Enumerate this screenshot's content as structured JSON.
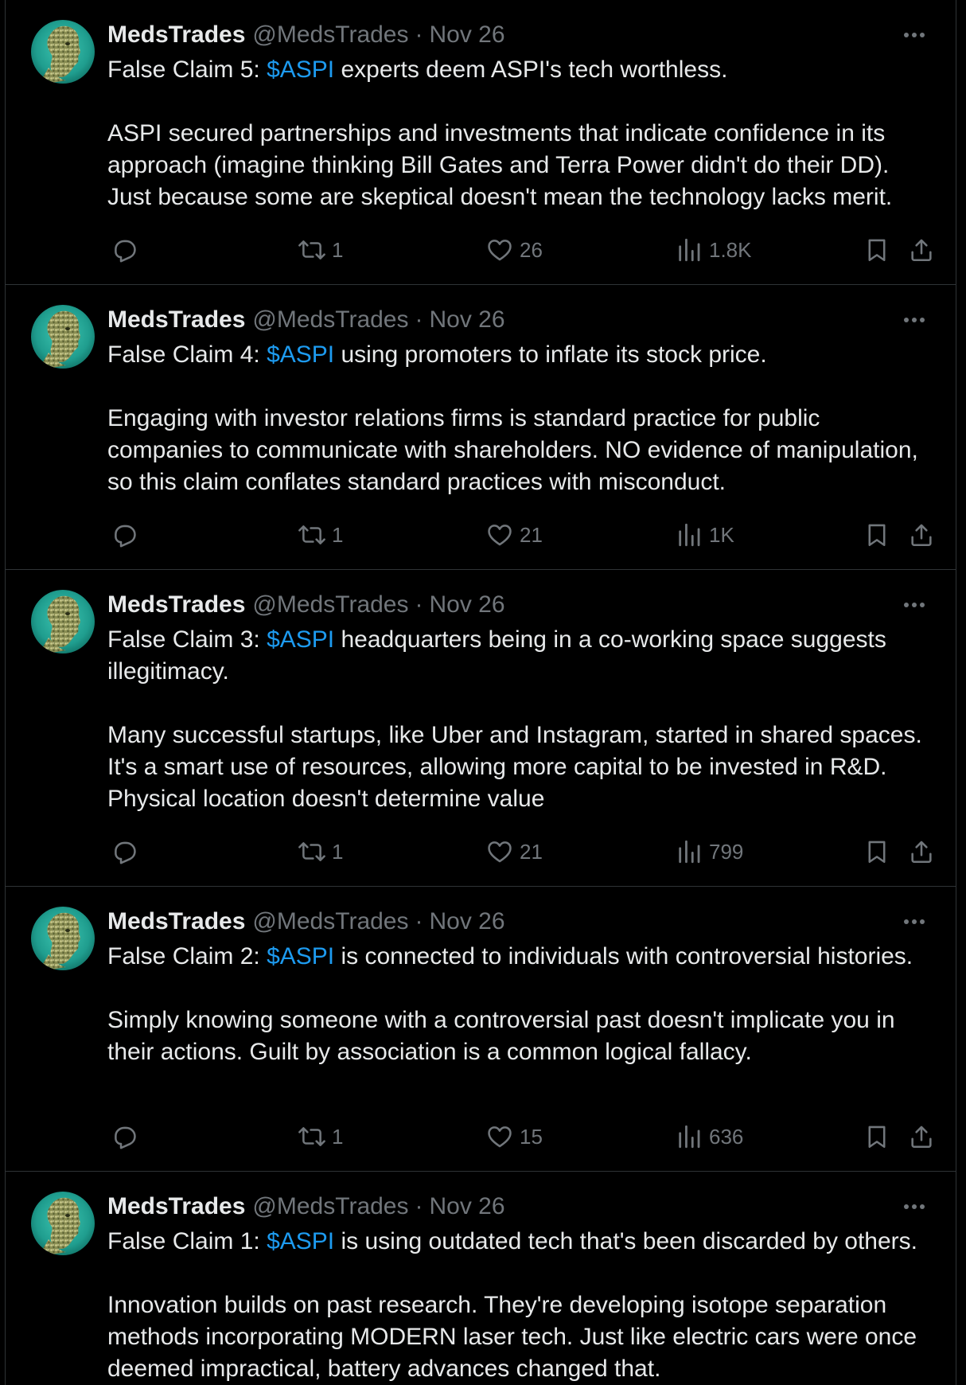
{
  "accent_color": "#1d9bf0",
  "tweets": [
    {
      "author": {
        "name": "MedsTrades",
        "handle": "@MedsTrades",
        "separator": "·",
        "date": "Nov 26"
      },
      "claim_prefix": "False Claim 5: ",
      "cashtag": "$ASPI",
      "claim_text": " experts deem ASPI's tech worthless.",
      "body": "ASPI secured partnerships and investments that indicate confidence in its approach (imagine thinking Bill Gates and Terra Power didn't do their DD). Just because some are skeptical doesn't mean the technology lacks merit.",
      "stats": {
        "replies": "",
        "retweets": "1",
        "likes": "26",
        "views": "1.8K"
      }
    },
    {
      "author": {
        "name": "MedsTrades",
        "handle": "@MedsTrades",
        "separator": "·",
        "date": "Nov 26"
      },
      "claim_prefix": "False Claim 4: ",
      "cashtag": "$ASPI",
      "claim_text": " using promoters to inflate its stock price.",
      "body": "Engaging with investor relations firms is standard practice for public companies to communicate with shareholders. NO evidence of manipulation, so this claim conflates standard practices with misconduct.",
      "stats": {
        "replies": "",
        "retweets": "1",
        "likes": "21",
        "views": "1K"
      }
    },
    {
      "author": {
        "name": "MedsTrades",
        "handle": "@MedsTrades",
        "separator": "·",
        "date": "Nov 26"
      },
      "claim_prefix": "False Claim 3: ",
      "cashtag": "$ASPI",
      "claim_text": " headquarters being in a co-working space suggests illegitimacy.",
      "body": "Many successful startups, like Uber and Instagram, started in shared spaces. It's a smart use of resources, allowing more capital to be invested in R&D. Physical location doesn't determine value",
      "stats": {
        "replies": "",
        "retweets": "1",
        "likes": "21",
        "views": "799"
      }
    },
    {
      "author": {
        "name": "MedsTrades",
        "handle": "@MedsTrades",
        "separator": "·",
        "date": "Nov 26"
      },
      "claim_prefix": "False Claim 2: ",
      "cashtag": "$ASPI",
      "claim_text": " is connected to individuals with controversial histories.",
      "body": "Simply knowing someone with a controversial past doesn't implicate you in their actions. Guilt by association is a common logical fallacy.",
      "stats": {
        "replies": "",
        "retweets": "1",
        "likes": "15",
        "views": "636"
      }
    },
    {
      "author": {
        "name": "MedsTrades",
        "handle": "@MedsTrades",
        "separator": "·",
        "date": "Nov 26"
      },
      "claim_prefix": "False Claim 1: ",
      "cashtag": "$ASPI",
      "claim_text": " is using outdated tech that's been discarded by others.",
      "body": "Innovation builds on past research. They're developing isotope separation methods incorporating MODERN laser tech. Just like electric cars were once deemed impractical, battery advances changed that.",
      "stats": {
        "replies": "",
        "retweets": "",
        "likes": "",
        "views": ""
      }
    }
  ]
}
